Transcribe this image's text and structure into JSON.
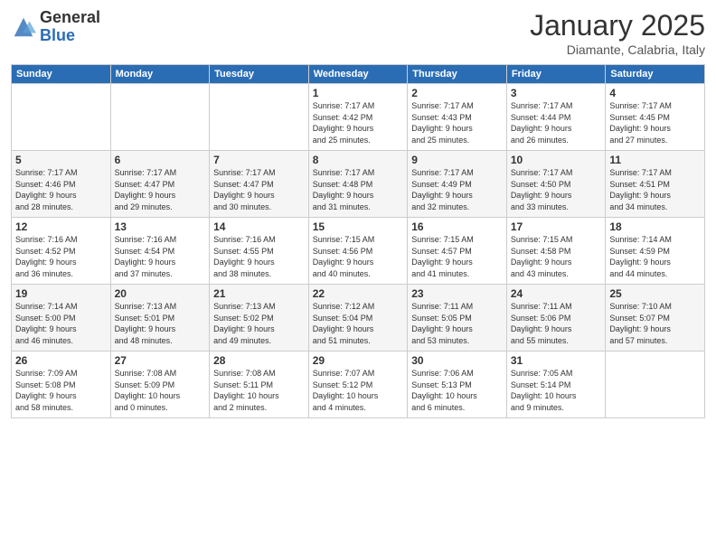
{
  "header": {
    "logo_general": "General",
    "logo_blue": "Blue",
    "title": "January 2025",
    "subtitle": "Diamante, Calabria, Italy"
  },
  "weekdays": [
    "Sunday",
    "Monday",
    "Tuesday",
    "Wednesday",
    "Thursday",
    "Friday",
    "Saturday"
  ],
  "weeks": [
    [
      {
        "day": "",
        "info": ""
      },
      {
        "day": "",
        "info": ""
      },
      {
        "day": "",
        "info": ""
      },
      {
        "day": "1",
        "info": "Sunrise: 7:17 AM\nSunset: 4:42 PM\nDaylight: 9 hours\nand 25 minutes."
      },
      {
        "day": "2",
        "info": "Sunrise: 7:17 AM\nSunset: 4:43 PM\nDaylight: 9 hours\nand 25 minutes."
      },
      {
        "day": "3",
        "info": "Sunrise: 7:17 AM\nSunset: 4:44 PM\nDaylight: 9 hours\nand 26 minutes."
      },
      {
        "day": "4",
        "info": "Sunrise: 7:17 AM\nSunset: 4:45 PM\nDaylight: 9 hours\nand 27 minutes."
      }
    ],
    [
      {
        "day": "5",
        "info": "Sunrise: 7:17 AM\nSunset: 4:46 PM\nDaylight: 9 hours\nand 28 minutes."
      },
      {
        "day": "6",
        "info": "Sunrise: 7:17 AM\nSunset: 4:47 PM\nDaylight: 9 hours\nand 29 minutes."
      },
      {
        "day": "7",
        "info": "Sunrise: 7:17 AM\nSunset: 4:47 PM\nDaylight: 9 hours\nand 30 minutes."
      },
      {
        "day": "8",
        "info": "Sunrise: 7:17 AM\nSunset: 4:48 PM\nDaylight: 9 hours\nand 31 minutes."
      },
      {
        "day": "9",
        "info": "Sunrise: 7:17 AM\nSunset: 4:49 PM\nDaylight: 9 hours\nand 32 minutes."
      },
      {
        "day": "10",
        "info": "Sunrise: 7:17 AM\nSunset: 4:50 PM\nDaylight: 9 hours\nand 33 minutes."
      },
      {
        "day": "11",
        "info": "Sunrise: 7:17 AM\nSunset: 4:51 PM\nDaylight: 9 hours\nand 34 minutes."
      }
    ],
    [
      {
        "day": "12",
        "info": "Sunrise: 7:16 AM\nSunset: 4:52 PM\nDaylight: 9 hours\nand 36 minutes."
      },
      {
        "day": "13",
        "info": "Sunrise: 7:16 AM\nSunset: 4:54 PM\nDaylight: 9 hours\nand 37 minutes."
      },
      {
        "day": "14",
        "info": "Sunrise: 7:16 AM\nSunset: 4:55 PM\nDaylight: 9 hours\nand 38 minutes."
      },
      {
        "day": "15",
        "info": "Sunrise: 7:15 AM\nSunset: 4:56 PM\nDaylight: 9 hours\nand 40 minutes."
      },
      {
        "day": "16",
        "info": "Sunrise: 7:15 AM\nSunset: 4:57 PM\nDaylight: 9 hours\nand 41 minutes."
      },
      {
        "day": "17",
        "info": "Sunrise: 7:15 AM\nSunset: 4:58 PM\nDaylight: 9 hours\nand 43 minutes."
      },
      {
        "day": "18",
        "info": "Sunrise: 7:14 AM\nSunset: 4:59 PM\nDaylight: 9 hours\nand 44 minutes."
      }
    ],
    [
      {
        "day": "19",
        "info": "Sunrise: 7:14 AM\nSunset: 5:00 PM\nDaylight: 9 hours\nand 46 minutes."
      },
      {
        "day": "20",
        "info": "Sunrise: 7:13 AM\nSunset: 5:01 PM\nDaylight: 9 hours\nand 48 minutes."
      },
      {
        "day": "21",
        "info": "Sunrise: 7:13 AM\nSunset: 5:02 PM\nDaylight: 9 hours\nand 49 minutes."
      },
      {
        "day": "22",
        "info": "Sunrise: 7:12 AM\nSunset: 5:04 PM\nDaylight: 9 hours\nand 51 minutes."
      },
      {
        "day": "23",
        "info": "Sunrise: 7:11 AM\nSunset: 5:05 PM\nDaylight: 9 hours\nand 53 minutes."
      },
      {
        "day": "24",
        "info": "Sunrise: 7:11 AM\nSunset: 5:06 PM\nDaylight: 9 hours\nand 55 minutes."
      },
      {
        "day": "25",
        "info": "Sunrise: 7:10 AM\nSunset: 5:07 PM\nDaylight: 9 hours\nand 57 minutes."
      }
    ],
    [
      {
        "day": "26",
        "info": "Sunrise: 7:09 AM\nSunset: 5:08 PM\nDaylight: 9 hours\nand 58 minutes."
      },
      {
        "day": "27",
        "info": "Sunrise: 7:08 AM\nSunset: 5:09 PM\nDaylight: 10 hours\nand 0 minutes."
      },
      {
        "day": "28",
        "info": "Sunrise: 7:08 AM\nSunset: 5:11 PM\nDaylight: 10 hours\nand 2 minutes."
      },
      {
        "day": "29",
        "info": "Sunrise: 7:07 AM\nSunset: 5:12 PM\nDaylight: 10 hours\nand 4 minutes."
      },
      {
        "day": "30",
        "info": "Sunrise: 7:06 AM\nSunset: 5:13 PM\nDaylight: 10 hours\nand 6 minutes."
      },
      {
        "day": "31",
        "info": "Sunrise: 7:05 AM\nSunset: 5:14 PM\nDaylight: 10 hours\nand 9 minutes."
      },
      {
        "day": "",
        "info": ""
      }
    ]
  ]
}
